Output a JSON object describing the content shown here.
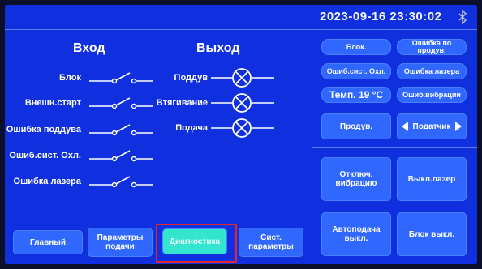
{
  "header": {
    "datetime": "2023-09-16 23:30:02",
    "bluetooth_icon": "bluetooth-icon"
  },
  "diagnostics": {
    "input_heading": "Вход",
    "output_heading": "Выход",
    "inputs": [
      {
        "label": "Блок"
      },
      {
        "label": "Внешн.старт"
      },
      {
        "label": "Ошибка поддува"
      },
      {
        "label": "Ошиб.сист. Охл."
      },
      {
        "label": "Ошибка лазера"
      }
    ],
    "outputs": [
      {
        "label": "Поддув"
      },
      {
        "label": "Втягивание"
      },
      {
        "label": "Подача"
      }
    ]
  },
  "status": {
    "block": "Блок.",
    "feed_error": "Ошибка по продув.",
    "cooling_error": "Ошиб.сист. Охл.",
    "laser_error": "Ошибка лазера",
    "temp": "Темп. 19 °C",
    "vibration_error": "Ошиб.вибрации"
  },
  "controls": {
    "blow": "Продув.",
    "sensor": "Податчик",
    "vibration_off": "Отключ. вибрацию",
    "laser_off": "Выкл.лазер",
    "autofeed_off": "Автоподача выкл.",
    "block_off": "Блок выкл."
  },
  "nav": {
    "main": "Главный",
    "feed_params": "Параметры подачи",
    "diagnostics": "Диагностика",
    "system_params": "Сист. параметры"
  },
  "colors": {
    "background": "#1030e0",
    "button": "#2f67ff",
    "active_button": "#33e5cf",
    "highlight": "#e0262e"
  }
}
